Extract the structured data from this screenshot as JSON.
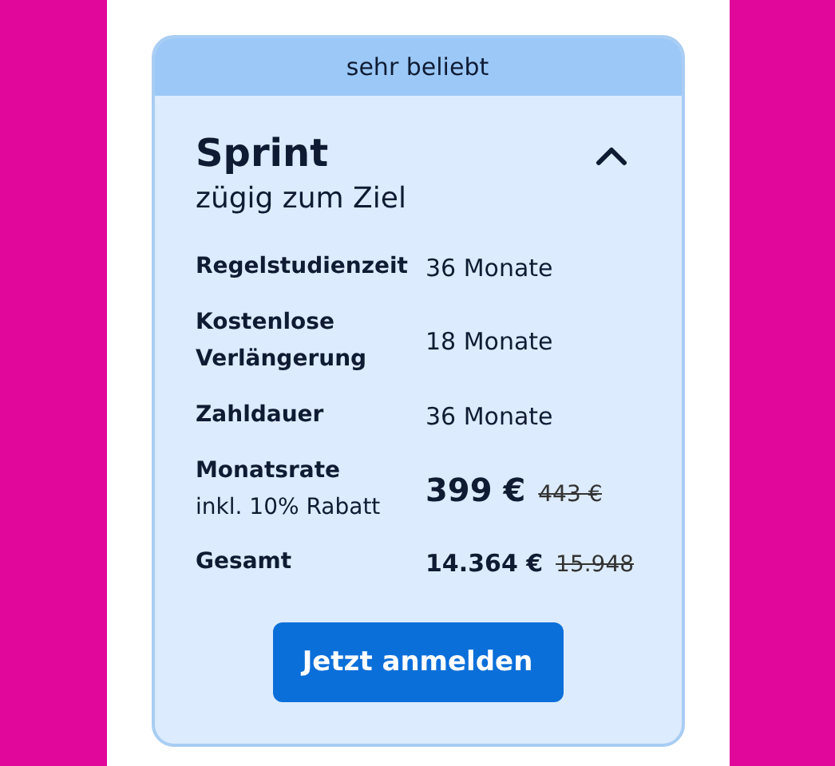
{
  "card": {
    "badge": "sehr beliebt",
    "title": "Sprint",
    "subtitle": "zügig zum Ziel",
    "expanded": true,
    "rows": [
      {
        "kind": "text",
        "label": "Regelstudienzeit",
        "value": "36 Monate"
      },
      {
        "kind": "text",
        "label": "Kostenlose Verlängerung",
        "value": "18 Monate"
      },
      {
        "kind": "text",
        "label": "Zahldauer",
        "value": "36 Monate"
      },
      {
        "kind": "price-large",
        "label": "Monatsrate",
        "sublabel": "inkl. 10% Rabatt",
        "value": "399 €",
        "old_value": "443 €"
      },
      {
        "kind": "price",
        "label": "Gesamt",
        "value": "14.364 €",
        "old_value": "15.948"
      }
    ],
    "button": "Jetzt anmelden"
  }
}
